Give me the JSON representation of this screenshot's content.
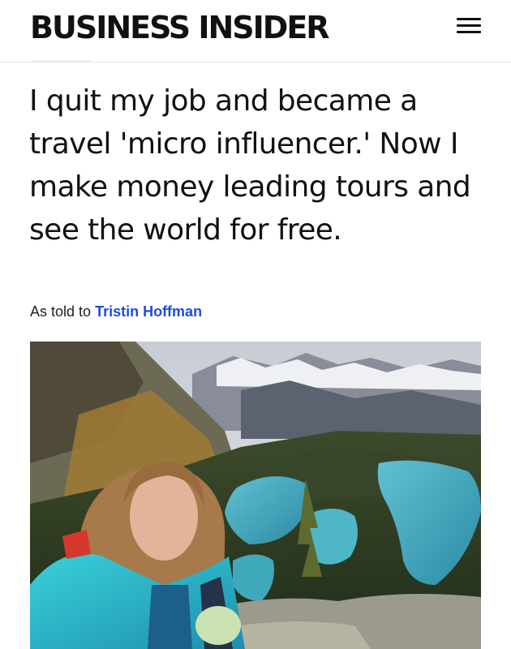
{
  "header": {
    "logo_text": "BUSINESS INSIDER",
    "menu_icon": "hamburger-menu-icon"
  },
  "article": {
    "headline": "I quit my job and became a travel 'micro influencer.' Now I make money leading tours and see the world for free.",
    "byline_prefix": "As told to",
    "author": "Tristin Hoffman"
  },
  "colors": {
    "author_link": "#1d4ed8",
    "text": "#111111"
  }
}
